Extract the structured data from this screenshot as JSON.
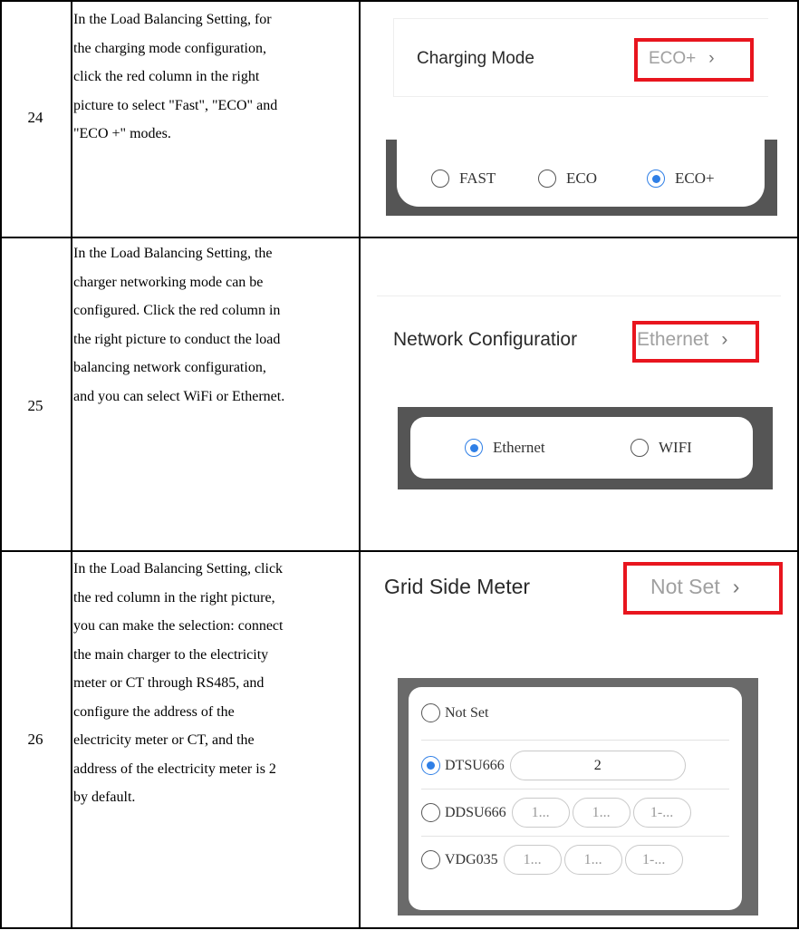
{
  "rows": [
    {
      "number": "24",
      "description": [
        "In the Load Balancing Setting, for",
        "the charging mode configuration,",
        "click the red column in the right",
        "picture to select \"Fast\", \"ECO\" and",
        "\"ECO +\" modes."
      ],
      "setting_label": "Charging Mode",
      "setting_value": "ECO+",
      "options": [
        {
          "label": "FAST",
          "selected": false
        },
        {
          "label": "ECO",
          "selected": false
        },
        {
          "label": "ECO+",
          "selected": true
        }
      ]
    },
    {
      "number": "25",
      "description": [
        "In the Load Balancing Setting, the",
        "charger networking mode can be",
        "configured. Click the red column in",
        "the right picture to conduct the load",
        "balancing network configuration,",
        "and you can select WiFi or Ethernet."
      ],
      "setting_label": "Network Configuratior",
      "setting_value": "Ethernet",
      "options": [
        {
          "label": "Ethernet",
          "selected": true
        },
        {
          "label": "WIFI",
          "selected": false
        }
      ]
    },
    {
      "number": "26",
      "description": [
        "In the Load Balancing Setting, click",
        "the red column in the right picture,",
        "you can make the selection: connect",
        "the main charger to the electricity",
        "meter or CT through RS485, and",
        "configure the address of the",
        "electricity meter or CT, and the",
        "address of the electricity meter is 2",
        "by default."
      ],
      "setting_label": "Grid Side Meter",
      "setting_value": "Not Set",
      "meters": [
        {
          "label": "Not Set",
          "selected": false,
          "fields": []
        },
        {
          "label": "DTSU666",
          "selected": true,
          "fields": [
            "2"
          ]
        },
        {
          "label": "DDSU666",
          "selected": false,
          "fields": [
            "1...",
            "1...",
            "1-..."
          ]
        },
        {
          "label": "VDG035",
          "selected": false,
          "fields": [
            "1...",
            "1...",
            "1-..."
          ]
        }
      ]
    }
  ],
  "icons": {
    "chevron": "chevron-right-icon",
    "radio": "radio-button-icon"
  },
  "colors": {
    "highlight": "#e8151e",
    "radio_selected": "#2f7fe6",
    "overlay": "#555555"
  }
}
